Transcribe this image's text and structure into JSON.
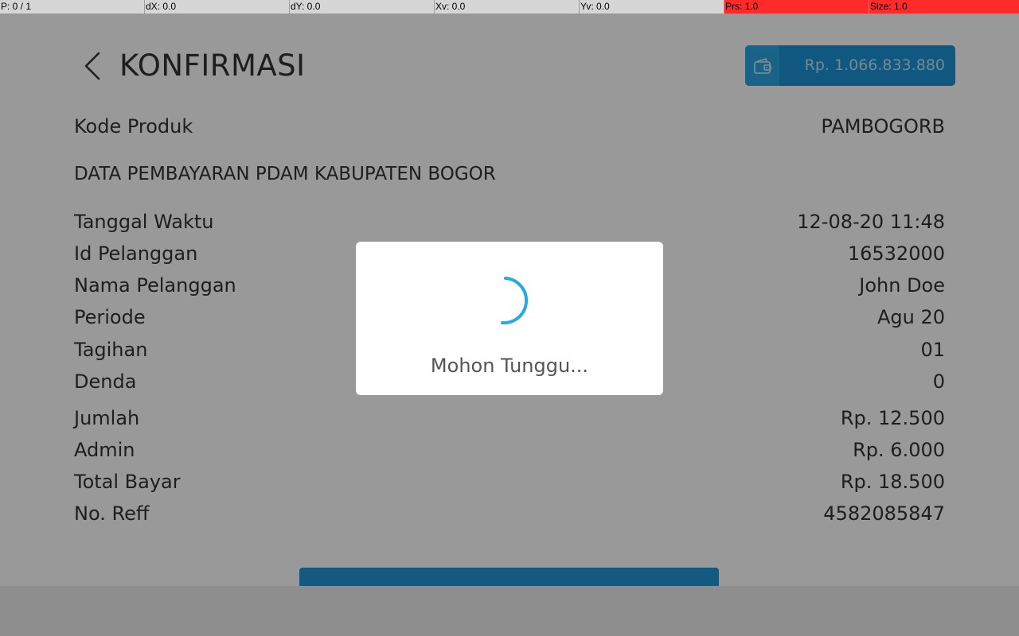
{
  "debug": {
    "p": "P: 0 / 1",
    "dx": "dX: 0.0",
    "dy": "dY: 0.0",
    "xv": "Xv: 0.0",
    "yv": "Yv: 0.0",
    "prs": "Prs: 1.0",
    "size": "Size: 1.0"
  },
  "header": {
    "title": "KONFIRMASI",
    "back_icon": "chevron-left-icon",
    "balance_icon": "wallet-icon",
    "balance": "Rp. 1.066.833.880"
  },
  "product": {
    "label": "Kode Produk",
    "value": "PAMBOGORB"
  },
  "section_title": "DATA PEMBAYARAN PDAM KABUPATEN BOGOR",
  "details": [
    {
      "label": "Tanggal Waktu",
      "value": "12-08-20 11:48"
    },
    {
      "label": "Id Pelanggan",
      "value": "16532000"
    },
    {
      "label": "Nama Pelanggan",
      "value": "John Doe"
    },
    {
      "label": "Periode",
      "value": "Agu 20"
    },
    {
      "label": "Tagihan",
      "value": "01"
    },
    {
      "label": "Denda",
      "value": "0"
    },
    {
      "label": "Jumlah",
      "value": "Rp. 12.500"
    },
    {
      "label": "Admin",
      "value": "Rp. 6.000"
    },
    {
      "label": "Total Bayar",
      "value": "Rp. 18.500"
    },
    {
      "label": "No. Reff",
      "value": "4582085847"
    }
  ],
  "dialog": {
    "message": "Mohon Tunggu..."
  },
  "colors": {
    "accent": "#1c93d6",
    "spinner": "#29a9e0",
    "debug_pressure": "#ff2a2a"
  }
}
